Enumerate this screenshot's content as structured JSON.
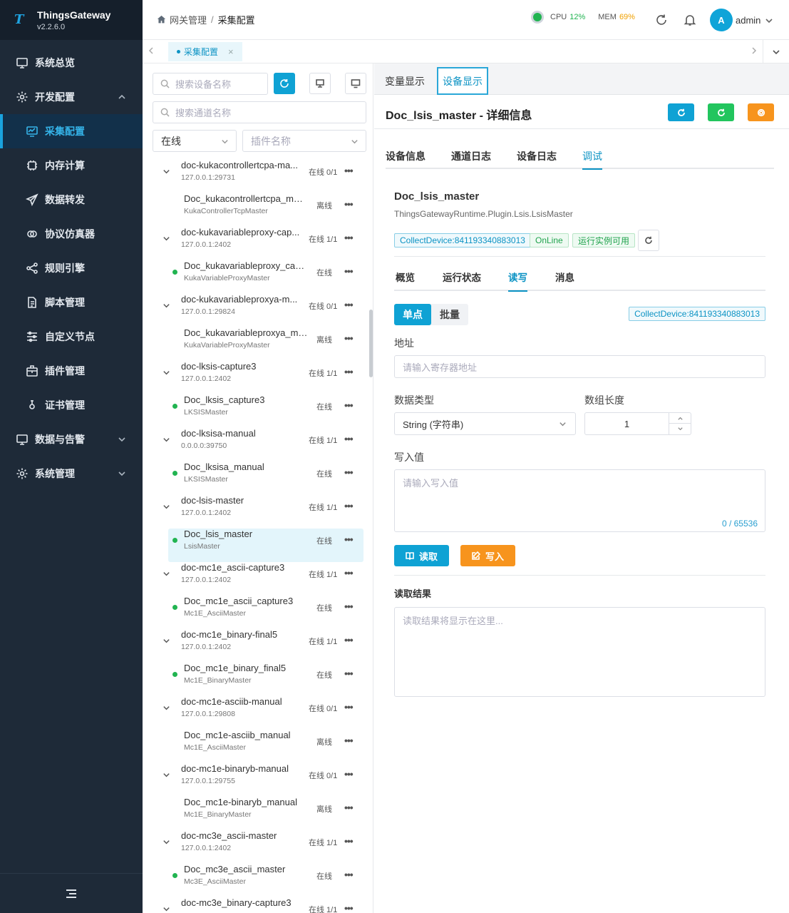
{
  "app": {
    "name": "ThingsGateway",
    "version": "v2.2.6.0"
  },
  "sidebar": {
    "items": [
      {
        "label": "系统总览",
        "icon": "monitor-icon",
        "type": "top"
      },
      {
        "label": "开发配置",
        "icon": "gear-icon",
        "type": "group",
        "expanded": true
      },
      {
        "label": "采集配置",
        "icon": "chart-icon",
        "type": "sub",
        "active": true
      },
      {
        "label": "内存计算",
        "icon": "chip-icon",
        "type": "sub"
      },
      {
        "label": "数据转发",
        "icon": "send-icon",
        "type": "sub"
      },
      {
        "label": "协议仿真器",
        "icon": "link-icon",
        "type": "sub"
      },
      {
        "label": "规则引擎",
        "icon": "share-icon",
        "type": "sub"
      },
      {
        "label": "脚本管理",
        "icon": "file-icon",
        "type": "sub"
      },
      {
        "label": "自定义节点",
        "icon": "sliders-icon",
        "type": "sub"
      },
      {
        "label": "插件管理",
        "icon": "package-icon",
        "type": "sub"
      },
      {
        "label": "证书管理",
        "icon": "certificate-icon",
        "type": "sub"
      },
      {
        "label": "数据与告警",
        "icon": "monitor-icon",
        "type": "group"
      },
      {
        "label": "系统管理",
        "icon": "gear-icon",
        "type": "group"
      }
    ]
  },
  "header": {
    "breadcrumb": [
      "网关管理",
      "采集配置"
    ],
    "cpu_label": "CPU",
    "cpu_value": "12%",
    "mem_label": "MEM",
    "mem_value": "69%",
    "user_initial": "A",
    "user_name": "admin"
  },
  "tabbar": {
    "active_tab": "采集配置",
    "close": "×"
  },
  "tree": {
    "device_search_placeholder": "搜索设备名称",
    "channel_search_placeholder": "搜索通道名称",
    "status_filter": "在线",
    "plugin_filter_placeholder": "插件名称",
    "more": "•••",
    "nodes": [
      {
        "kind": "channel",
        "name": "doc-kukacontrollertcpa-ma...",
        "address": "127.0.0.1:29731",
        "status": "在线 0/1"
      },
      {
        "kind": "device",
        "name": "Doc_kukacontrollertcpa_man...",
        "plugin": "KukaControllerTcpMaster",
        "status": "离线",
        "online": false
      },
      {
        "kind": "channel",
        "name": "doc-kukavariableproxy-cap...",
        "address": "127.0.0.1:2402",
        "status": "在线 1/1"
      },
      {
        "kind": "device",
        "name": "Doc_kukavariableproxy_capt...",
        "plugin": "KukaVariableProxyMaster",
        "status": "在线",
        "online": true
      },
      {
        "kind": "channel",
        "name": "doc-kukavariableproxya-m...",
        "address": "127.0.0.1:29824",
        "status": "在线 0/1"
      },
      {
        "kind": "device",
        "name": "Doc_kukavariableproxya_ma...",
        "plugin": "KukaVariableProxyMaster",
        "status": "离线",
        "online": false
      },
      {
        "kind": "channel",
        "name": "doc-lksis-capture3",
        "address": "127.0.0.1:2402",
        "status": "在线 1/1"
      },
      {
        "kind": "device",
        "name": "Doc_lksis_capture3",
        "plugin": "LKSISMaster",
        "status": "在线",
        "online": true
      },
      {
        "kind": "channel",
        "name": "doc-lksisa-manual",
        "address": "0.0.0.0:39750",
        "status": "在线 1/1"
      },
      {
        "kind": "device",
        "name": "Doc_lksisa_manual",
        "plugin": "LKSISMaster",
        "status": "在线",
        "online": true
      },
      {
        "kind": "channel",
        "name": "doc-lsis-master",
        "address": "127.0.0.1:2402",
        "status": "在线 1/1"
      },
      {
        "kind": "device",
        "name": "Doc_lsis_master",
        "plugin": "LsisMaster",
        "status": "在线",
        "online": true,
        "active": true
      },
      {
        "kind": "channel",
        "name": "doc-mc1e_ascii-capture3",
        "address": "127.0.0.1:2402",
        "status": "在线 1/1"
      },
      {
        "kind": "device",
        "name": "Doc_mc1e_ascii_capture3",
        "plugin": "Mc1E_AsciiMaster",
        "status": "在线",
        "online": true
      },
      {
        "kind": "channel",
        "name": "doc-mc1e_binary-final5",
        "address": "127.0.0.1:2402",
        "status": "在线 1/1"
      },
      {
        "kind": "device",
        "name": "Doc_mc1e_binary_final5",
        "plugin": "Mc1E_BinaryMaster",
        "status": "在线",
        "online": true
      },
      {
        "kind": "channel",
        "name": "doc-mc1e-asciib-manual",
        "address": "127.0.0.1:29808",
        "status": "在线 0/1"
      },
      {
        "kind": "device",
        "name": "Doc_mc1e-asciib_manual",
        "plugin": "Mc1E_AsciiMaster",
        "status": "离线",
        "online": false
      },
      {
        "kind": "channel",
        "name": "doc-mc1e-binaryb-manual",
        "address": "127.0.0.1:29755",
        "status": "在线 0/1"
      },
      {
        "kind": "device",
        "name": "Doc_mc1e-binaryb_manual",
        "plugin": "Mc1E_BinaryMaster",
        "status": "离线",
        "online": false
      },
      {
        "kind": "channel",
        "name": "doc-mc3e_ascii-master",
        "address": "127.0.0.1:2402",
        "status": "在线 1/1"
      },
      {
        "kind": "device",
        "name": "Doc_mc3e_ascii_master",
        "plugin": "Mc3E_AsciiMaster",
        "status": "在线",
        "online": true
      },
      {
        "kind": "channel",
        "name": "doc-mc3e_binary-capture3",
        "address": "",
        "status": "在线 1/1"
      }
    ]
  },
  "main": {
    "view_tabs": [
      "变量显示",
      "设备显示"
    ],
    "detail_title": "Doc_lsis_master - 详细信息",
    "sub_tabs": [
      "设备信息",
      "通道日志",
      "设备日志",
      "调试"
    ],
    "device_name": "Doc_lsis_master",
    "device_plugin": "ThingsGatewayRuntime.Plugin.Lsis.LsisMaster",
    "badges": [
      "CollectDevice:841193340883013",
      "OnLine",
      "运行实例可用"
    ],
    "inner_tabs": [
      "概览",
      "运行状态",
      "读写",
      "消息"
    ],
    "mode_tabs": [
      "单点",
      "批量"
    ],
    "device_badge": "CollectDevice:841193340883013",
    "address_label": "地址",
    "address_placeholder": "请输入寄存器地址",
    "data_type_label": "数据类型",
    "data_type_value": "String (字符串)",
    "array_length_label": "数组长度",
    "array_length_value": "1",
    "write_value_label": "写入值",
    "write_value_placeholder": "请输入写入值",
    "write_counter": "0 / 65536",
    "read_button": "读取",
    "write_button": "写入",
    "read_result_title": "读取结果",
    "read_result_placeholder": "读取结果将显示在这里..."
  },
  "colors": {
    "accent": "#0fa2d4",
    "success": "#21b451",
    "warning": "#f7941d",
    "sidebar_bg": "#1e2a38"
  }
}
